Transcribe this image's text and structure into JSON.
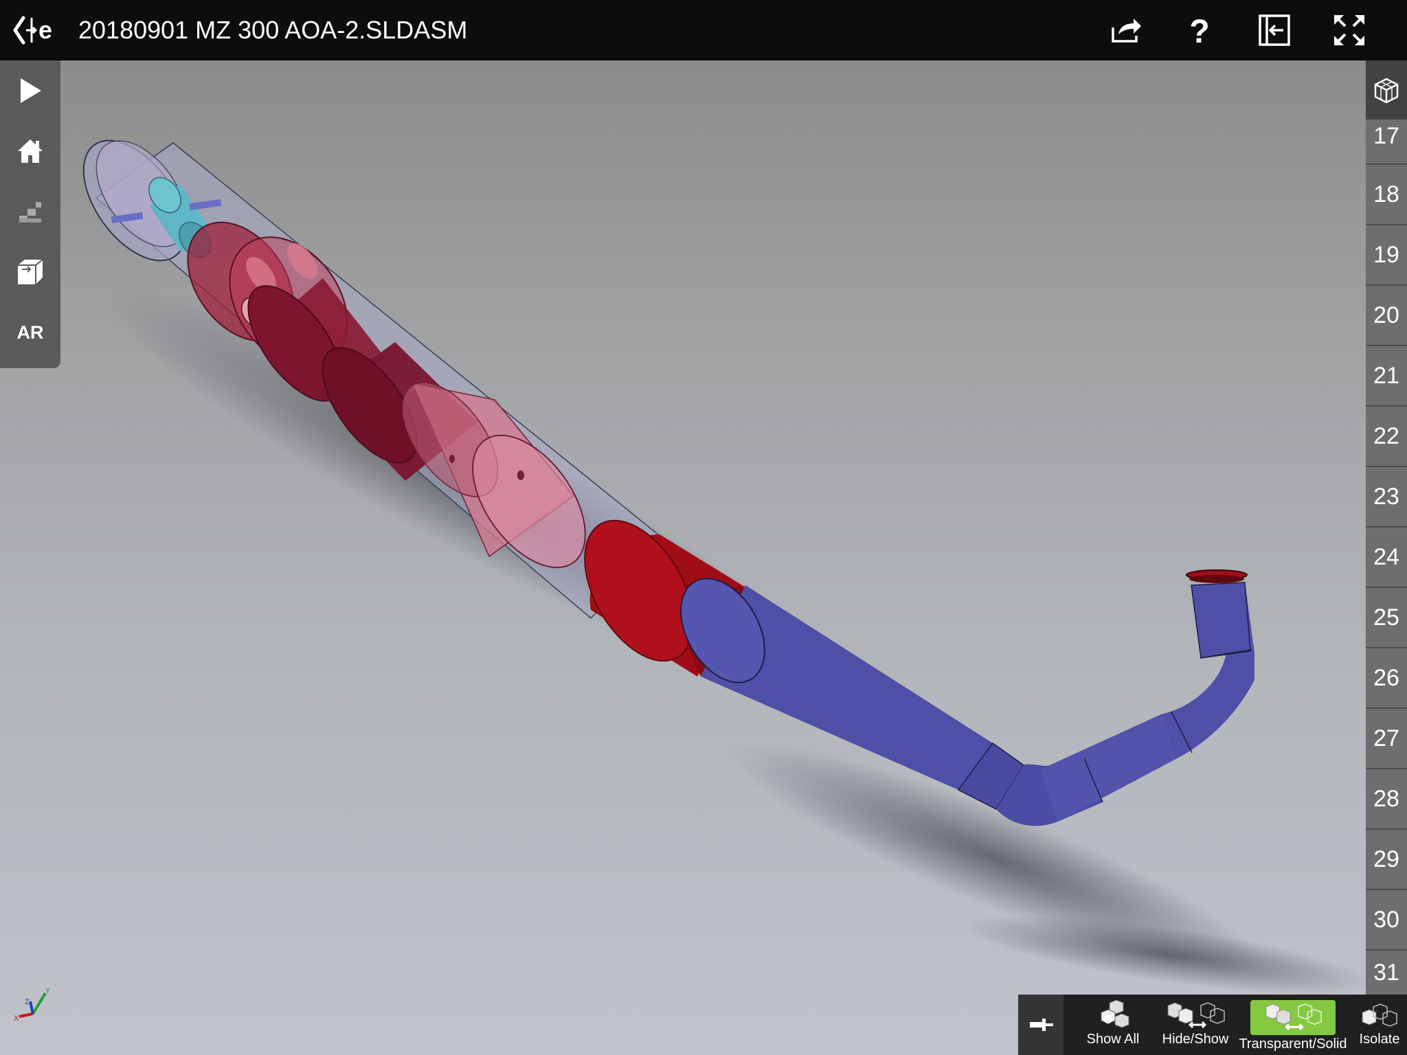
{
  "app": {
    "title": "20180901 MZ 300 AOA-2.SLDASM",
    "logo_icon": "back-edrawings-logo-icon"
  },
  "topbar": {
    "icons": [
      "share-icon",
      "help-icon",
      "collapse-panel-icon",
      "fullscreen-icon"
    ]
  },
  "left_toolbar": {
    "items": [
      {
        "icon": "play-icon"
      },
      {
        "icon": "home-icon"
      },
      {
        "icon": "stairs-icon"
      },
      {
        "icon": "cube-section-icon"
      },
      {
        "icon": "ar-icon",
        "label": "AR"
      }
    ]
  },
  "right_panel": {
    "icon": "configurations-cube-icon",
    "numbers": [
      "17",
      "18",
      "19",
      "20",
      "21",
      "22",
      "23",
      "24",
      "25",
      "26",
      "27",
      "28",
      "29",
      "30",
      "31"
    ]
  },
  "bottom_toolbar": {
    "pin_icon": "pin-icon",
    "buttons": [
      {
        "label": "Show All",
        "icon": "show-all-icon",
        "active": false
      },
      {
        "label": "Hide/Show",
        "icon": "hide-show-icon",
        "active": false
      },
      {
        "label": "Transparent/Solid",
        "icon": "transparent-solid-icon",
        "active": true
      },
      {
        "label": "Isolate",
        "icon": "isolate-icon",
        "active": false
      }
    ]
  },
  "axis": {
    "x": "X",
    "y": "Y",
    "z": "Z"
  },
  "colors": {
    "topbar": "#0d0d0d",
    "active_button": "#84c940",
    "muffler_red": "#a01020",
    "pipe_blue": "#4e4fa6",
    "canister": "#a8a9c2"
  }
}
